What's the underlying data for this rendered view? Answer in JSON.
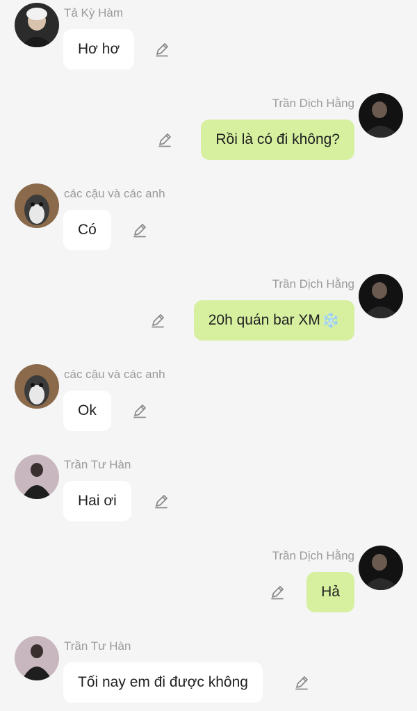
{
  "messages": [
    {
      "id": 1,
      "side": "left",
      "sender": "Tả Kỳ Hàm",
      "text": "Hơ hơ",
      "avatar": "avatar-ta-ky-ham"
    },
    {
      "id": 2,
      "side": "right",
      "sender": "Trần Dịch Hằng",
      "text": "Rồi là có đi không?",
      "avatar": "avatar-tran-dich-hang"
    },
    {
      "id": 3,
      "side": "left",
      "sender": "các cậu và các anh",
      "text": "Có",
      "avatar": "avatar-penguin"
    },
    {
      "id": 4,
      "side": "right",
      "sender": "Trần Dịch Hằng",
      "text": "20h quán bar XM",
      "emoji": "❄️",
      "avatar": "avatar-tran-dich-hang"
    },
    {
      "id": 5,
      "side": "left",
      "sender": "các cậu và các anh",
      "text": "Ok",
      "avatar": "avatar-penguin"
    },
    {
      "id": 6,
      "side": "left",
      "sender": "Trần Tư Hàn",
      "text": "Hai ơi",
      "avatar": "avatar-tran-tu-han"
    },
    {
      "id": 7,
      "side": "right",
      "sender": "Trần Dịch Hằng",
      "text": "Hả",
      "avatar": "avatar-tran-dich-hang"
    },
    {
      "id": 8,
      "side": "left",
      "sender": "Trần Tư Hàn",
      "text": "Tối nay em đi được không",
      "avatar": "avatar-tran-tu-han"
    }
  ],
  "icons": {
    "edit": "pencil-icon"
  },
  "colors": {
    "background": "#f5f5f5",
    "incoming_bubble": "#ffffff",
    "outgoing_bubble": "#d6f0a0",
    "sender_name": "#9a9a9a"
  }
}
